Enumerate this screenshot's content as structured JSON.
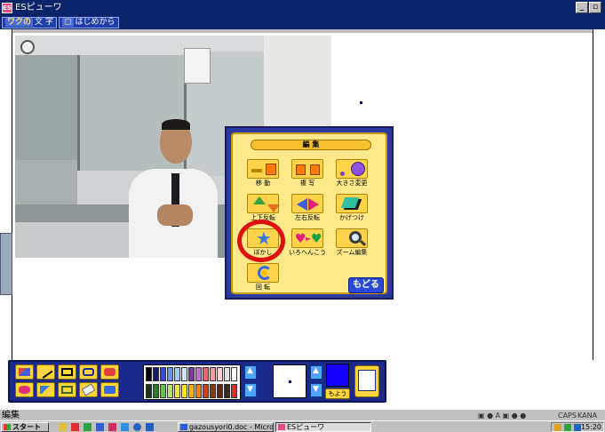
{
  "window": {
    "title": "ESピューワ",
    "app_icon_text": "ES",
    "minimize_label": "_",
    "maximize_label": "▫"
  },
  "menu": {
    "moji_tag": "ワクの",
    "moji_label": "文 字",
    "restart_label": "はじめから"
  },
  "edit_panel": {
    "title": "編 集",
    "tools": [
      {
        "label": "移 動",
        "icon": "move-icon"
      },
      {
        "label": "複 写",
        "icon": "copy-icon"
      },
      {
        "label": "大きさ変更",
        "icon": "resize-icon"
      },
      {
        "label": "上下反転",
        "icon": "flip-vertical-icon"
      },
      {
        "label": "左右反転",
        "icon": "flip-horizontal-icon"
      },
      {
        "label": "かげつけ",
        "icon": "shadow-icon"
      },
      {
        "label": "ぼかし",
        "icon": "blur-star-icon"
      },
      {
        "label": "いろへんこう",
        "icon": "color-change-icon"
      },
      {
        "label": "ズーム編集",
        "icon": "zoom-edit-icon"
      },
      {
        "label": "回 転",
        "icon": "rotate-icon"
      }
    ],
    "back_label": "もどる"
  },
  "toolbar": {
    "pattern_label": "もよう",
    "palette_top": [
      "#000000",
      "#1a1a6a",
      "#3a4adf",
      "#6f8ff0",
      "#a0c8ff",
      "#d0e6ff",
      "#7a3a9a",
      "#c070d0",
      "#f06070",
      "#ff9a9a",
      "#ffd0d0",
      "#e0e0e0",
      "#ffffff"
    ],
    "palette_bottom": [
      "#203020",
      "#2e7a2e",
      "#6ac040",
      "#b8e060",
      "#e8e838",
      "#ffea00",
      "#ffb000",
      "#ff7a00",
      "#d84010",
      "#8a3a1a",
      "#5a2a1a",
      "#3a2a20",
      "#ff2020"
    ],
    "current_color": "#1400ff"
  },
  "status": {
    "text": "編集",
    "ime_items": [
      "CAPS",
      "KANA"
    ]
  },
  "taskbar": {
    "start_label": "スタート",
    "tasks": [
      {
        "label": "gazousyori0.doc - Micros...",
        "active": false
      },
      {
        "label": "ESピューワ",
        "active": true
      }
    ],
    "clock": "15:20"
  }
}
